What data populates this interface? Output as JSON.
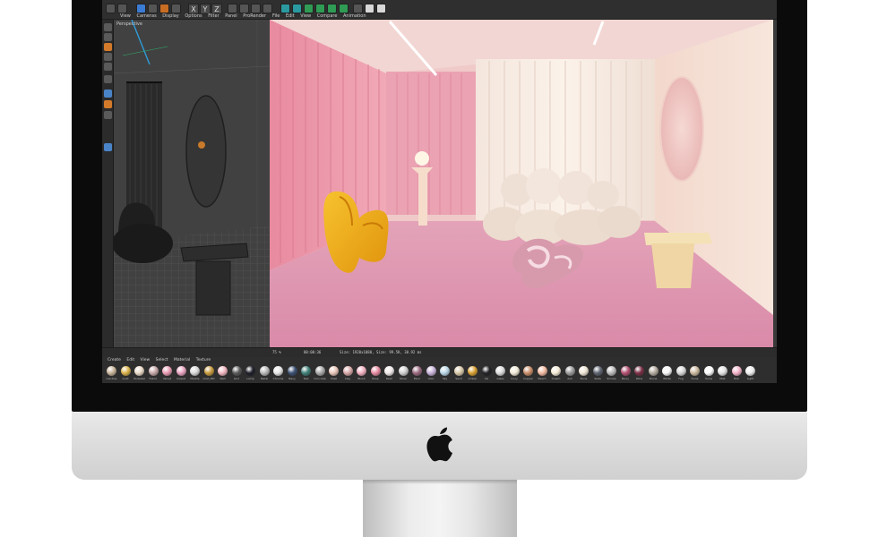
{
  "app": {
    "menu_main": [
      "View",
      "Cameras",
      "Display",
      "Options",
      "Filter",
      "Panel",
      "ProRender"
    ],
    "menu_render": [
      "File",
      "Edit",
      "View",
      "Compare",
      "Animation"
    ],
    "axis_buttons": [
      "X",
      "Y",
      "Z"
    ]
  },
  "viewport": {
    "label": "Perspective",
    "footer": "Grid Spacing : 10000 cm"
  },
  "status": {
    "zoom": "75 %",
    "time": "00:00:36",
    "size": "Size: 1920x1080, Size: 99.5K, 30.92 ms"
  },
  "material_manager": {
    "menu": [
      "Create",
      "Edit",
      "View",
      "Select",
      "Material",
      "Texture"
    ],
    "swatches": [
      {
        "label": "Candles",
        "color": "#c8b49a"
      },
      {
        "label": "Gold",
        "color": "#d9b24a"
      },
      {
        "label": "Pedestal",
        "color": "#e8d9c6"
      },
      {
        "label": "Fabric",
        "color": "#c6a7a7"
      },
      {
        "label": "Velvet",
        "color": "#e79ab0"
      },
      {
        "label": "Carpet",
        "color": "#e8a3c0"
      },
      {
        "label": "Marble",
        "color": "#d8d8d8"
      },
      {
        "label": "Gold_Mtl",
        "color": "#c79a3d"
      },
      {
        "label": "Wall",
        "color": "#f0b6c0"
      },
      {
        "label": "Grid",
        "color": "#5a5a5a"
      },
      {
        "label": "Lamp",
        "color": "#1e1e2a"
      },
      {
        "label": "Metal",
        "color": "#b8b8b8"
      },
      {
        "label": "Chrome",
        "color": "#e6e6e6"
      },
      {
        "label": "Navy",
        "color": "#3a4f72"
      },
      {
        "label": "Teal",
        "color": "#3f7f77"
      },
      {
        "label": "Concrete",
        "color": "#a9a9a9"
      },
      {
        "label": "Shell",
        "color": "#e8c6b8"
      },
      {
        "label": "Clay",
        "color": "#d7a6a6"
      },
      {
        "label": "Blush",
        "color": "#f1b0c0"
      },
      {
        "label": "Rose",
        "color": "#e68aa0"
      },
      {
        "label": "Pearl",
        "color": "#efe8e8"
      },
      {
        "label": "Silver",
        "color": "#cfcfcf"
      },
      {
        "label": "Plum",
        "color": "#9a6a80"
      },
      {
        "label": "Lilac",
        "color": "#c7b2d8"
      },
      {
        "label": "Sky",
        "color": "#b8d6e6"
      },
      {
        "label": "Sand",
        "color": "#d7c7a7"
      },
      {
        "label": "Amber",
        "color": "#d8a030"
      },
      {
        "label": "Ink",
        "color": "#222226"
      },
      {
        "label": "Glass",
        "color": "#dcdcdc"
      },
      {
        "label": "Ivory",
        "color": "#f1ead8"
      },
      {
        "label": "Copper",
        "color": "#c98d68"
      },
      {
        "label": "Peach",
        "color": "#f2b9a0"
      },
      {
        "label": "Cream",
        "color": "#f4ead6"
      },
      {
        "label": "Ash",
        "color": "#9a9a9a"
      },
      {
        "label": "Bone",
        "color": "#ece3d3"
      },
      {
        "label": "Slate",
        "color": "#5d6370"
      },
      {
        "label": "Smoke",
        "color": "#b9b9b9"
      },
      {
        "label": "Berry",
        "color": "#b05070"
      },
      {
        "label": "Wine",
        "color": "#7a2f45"
      },
      {
        "label": "Stone",
        "color": "#b3aa9e"
      },
      {
        "label": "White",
        "color": "#f6f6f6"
      },
      {
        "label": "Fog",
        "color": "#d6d6d6"
      },
      {
        "label": "Dune",
        "color": "#cbb89e"
      },
      {
        "label": "Snow",
        "color": "#fafafa"
      },
      {
        "label": "Mist",
        "color": "#e2e2e2"
      },
      {
        "label": "Pink",
        "color": "#f3b3c7"
      },
      {
        "label": "Light",
        "color": "#eeeeee"
      }
    ]
  }
}
